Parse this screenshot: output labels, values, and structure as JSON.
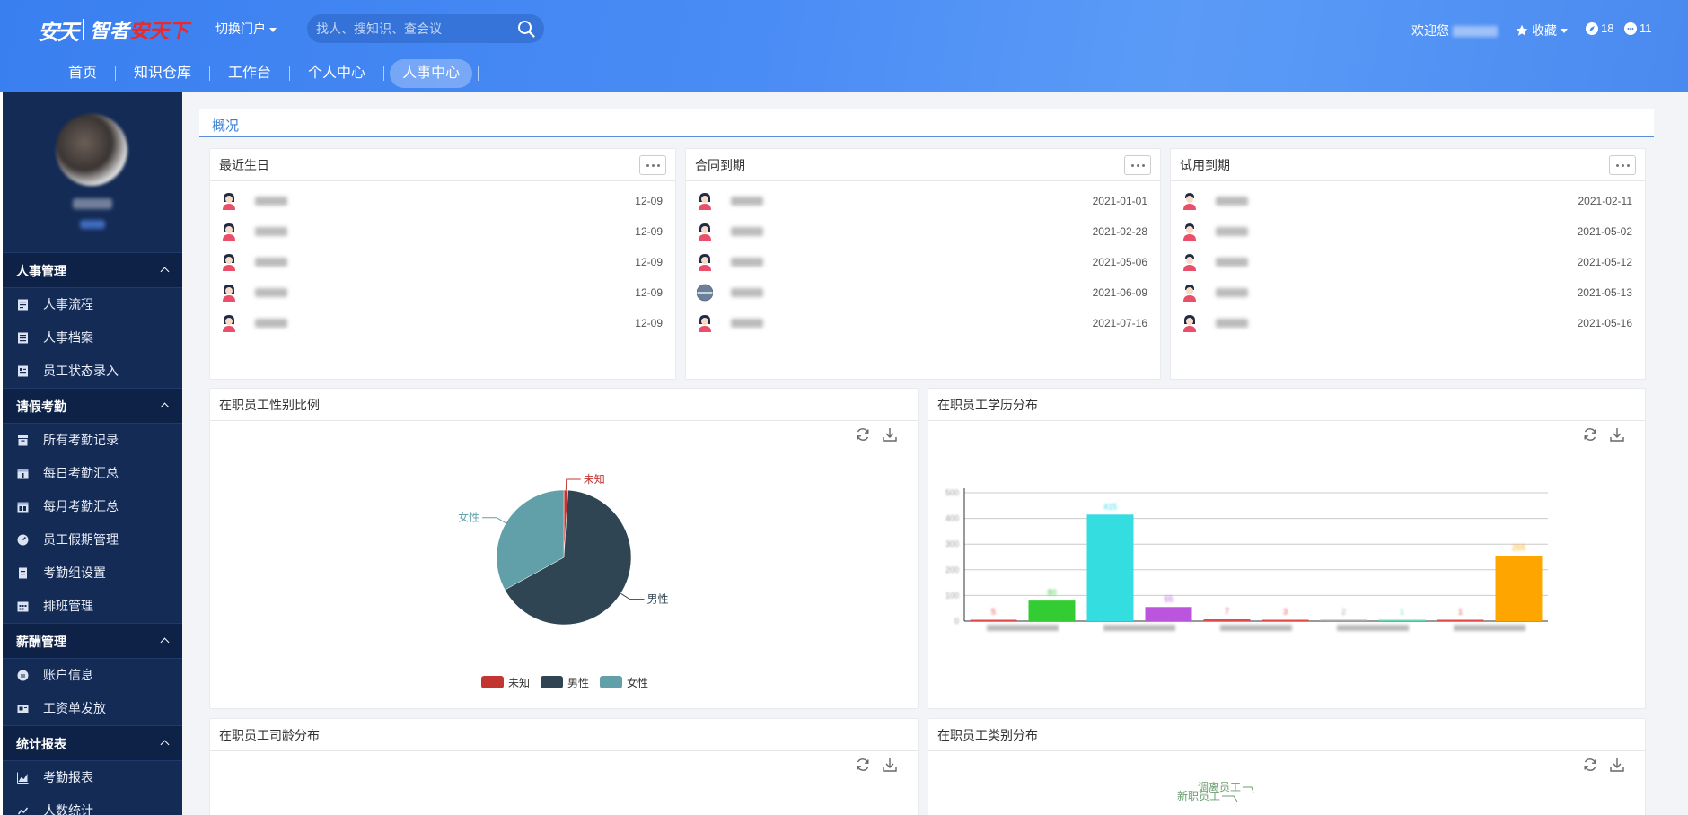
{
  "header": {
    "logo_mark": "安天",
    "slogan_part1": "智者",
    "slogan_part2": "安天下",
    "portal_switch": "切换门户",
    "search_placeholder": "找人、搜知识、查会议",
    "welcome": "欢迎您",
    "favorites": "收藏",
    "count_tasks": "18",
    "count_messages": "11"
  },
  "nav": {
    "items": [
      {
        "label": "首页"
      },
      {
        "label": "知识仓库"
      },
      {
        "label": "工作台"
      },
      {
        "label": "个人中心"
      },
      {
        "label": "人事中心"
      }
    ],
    "active": "人事中心"
  },
  "sidebar": {
    "groups": [
      {
        "title": "人事管理",
        "items": [
          "人事流程",
          "人事档案",
          "员工状态录入"
        ]
      },
      {
        "title": "请假考勤",
        "items": [
          "所有考勤记录",
          "每日考勤汇总",
          "每月考勤汇总",
          "员工假期管理",
          "考勤组设置",
          "排班管理"
        ]
      },
      {
        "title": "薪酬管理",
        "items": [
          "账户信息",
          "工资单发放"
        ]
      },
      {
        "title": "统计报表",
        "items": [
          "考勤报表",
          "人数统计"
        ]
      }
    ]
  },
  "page": {
    "section_title": "概况"
  },
  "birthday_card": {
    "title": "最近生日",
    "rows": [
      {
        "date": "12-09"
      },
      {
        "date": "12-09"
      },
      {
        "date": "12-09"
      },
      {
        "date": "12-09"
      },
      {
        "date": "12-09"
      }
    ]
  },
  "contract_card": {
    "title": "合同到期",
    "rows": [
      {
        "date": "2021-01-01"
      },
      {
        "date": "2021-02-28"
      },
      {
        "date": "2021-05-06"
      },
      {
        "date": "2021-06-09"
      },
      {
        "date": "2021-07-16"
      }
    ]
  },
  "probation_card": {
    "title": "试用到期",
    "rows": [
      {
        "date": "2021-02-11"
      },
      {
        "date": "2021-05-02"
      },
      {
        "date": "2021-05-12"
      },
      {
        "date": "2021-05-13"
      },
      {
        "date": "2021-05-16"
      }
    ]
  },
  "gender_chart": {
    "title": "在职员工性别比例"
  },
  "education_chart": {
    "title": "在职员工学历分布"
  },
  "seniority_chart": {
    "title": "在职员工司龄分布"
  },
  "category_chart": {
    "title": "在职员工类别分布",
    "visible_labels": [
      "调离员工",
      "新职员工"
    ]
  },
  "chart_data": [
    {
      "type": "pie",
      "title": "在职员工性别比例",
      "categories": [
        "未知",
        "男性",
        "女性"
      ],
      "values": [
        1,
        66,
        33
      ],
      "colors": [
        "#c23531",
        "#2f4554",
        "#61a0a8"
      ],
      "legend_position": "bottom"
    },
    {
      "type": "bar",
      "title": "在职员工学历分布",
      "categories": [
        "cat1",
        "cat2",
        "cat3",
        "cat4",
        "cat5",
        "cat6",
        "cat7",
        "cat8",
        "cat9",
        "cat10"
      ],
      "values": [
        5,
        80,
        415,
        55,
        7,
        3,
        2,
        1,
        1,
        255
      ],
      "colors": [
        "#e24a4a",
        "#33cc33",
        "#33dde0",
        "#bb55dd",
        "#e24a4a",
        "#e24a4a",
        "#aaaaaa",
        "#66d9b0",
        "#e24a4a",
        "#ffa500"
      ],
      "ylim": [
        0,
        500
      ],
      "yticks": [
        "0",
        "100",
        "200",
        "300",
        "400",
        "500"
      ],
      "grid": true
    }
  ]
}
